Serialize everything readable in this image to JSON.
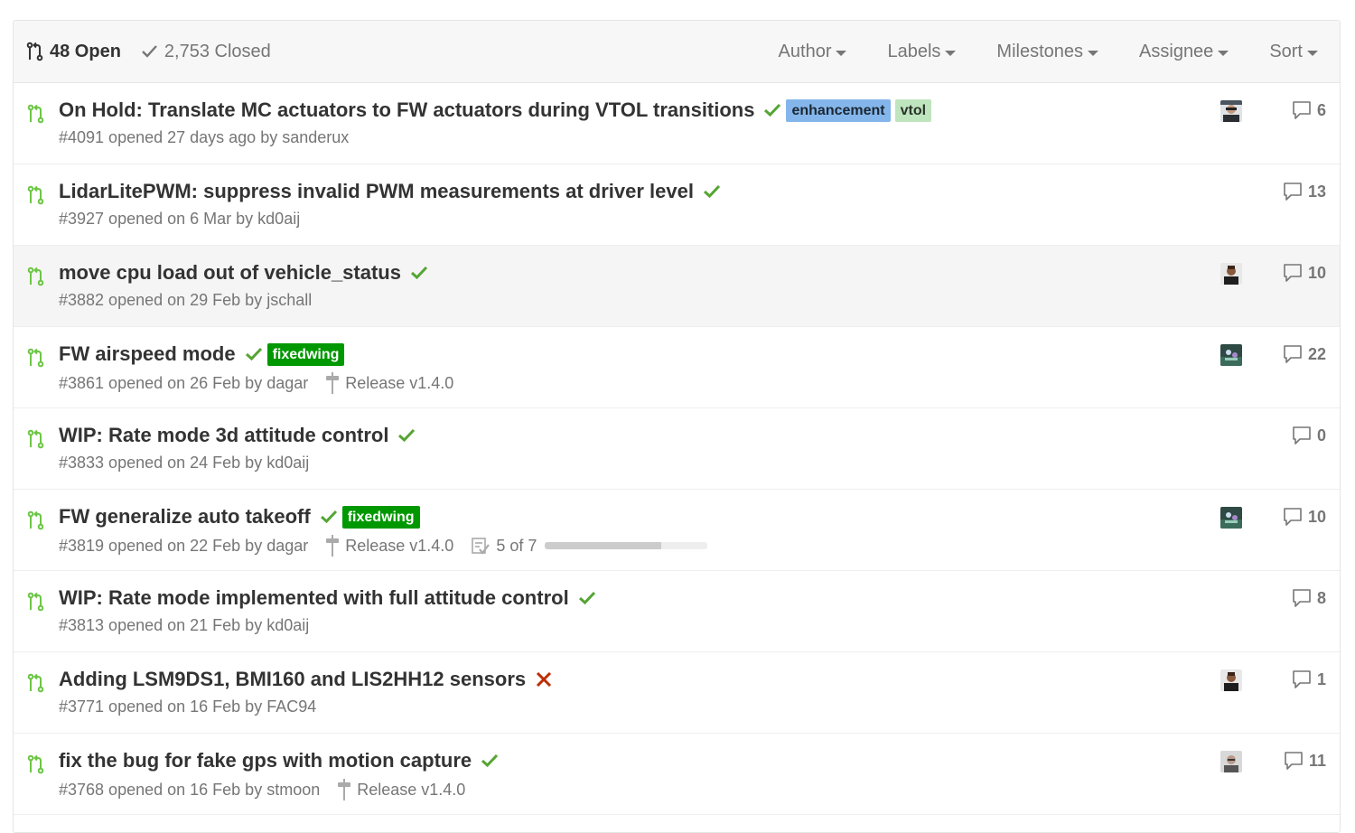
{
  "header": {
    "open_label": "48 Open",
    "closed_label": "2,753 Closed",
    "filters": [
      "Author",
      "Labels",
      "Milestones",
      "Assignee",
      "Sort"
    ]
  },
  "colors": {
    "success": "#55a532",
    "failure": "#bd2c00",
    "pr_open": "#6cc644"
  },
  "pull_requests": [
    {
      "title": "On Hold: Translate MC actuators to FW actuators during VTOL transitions",
      "status": "success",
      "labels": [
        {
          "name": "enhancement",
          "style": "enhancement"
        },
        {
          "name": "vtol",
          "style": "vtol"
        }
      ],
      "meta": "#4091 opened 27 days ago by sanderux",
      "milestone": null,
      "avatar": "avatar-a",
      "comments": "6"
    },
    {
      "title": "LidarLitePWM: suppress invalid PWM measurements at driver level",
      "status": "success",
      "labels": [],
      "meta": "#3927 opened on 6 Mar by kd0aij",
      "milestone": null,
      "avatar": null,
      "comments": "13"
    },
    {
      "title": "move cpu load out of vehicle_status",
      "status": "success",
      "labels": [],
      "meta": "#3882 opened on 29 Feb by jschall",
      "milestone": null,
      "avatar": "avatar-b",
      "comments": "10",
      "highlighted": true
    },
    {
      "title": "FW airspeed mode",
      "status": "success",
      "labels": [
        {
          "name": "fixedwing",
          "style": "fixedwing"
        }
      ],
      "meta": "#3861 opened on 26 Feb by dagar",
      "milestone": "Release v1.4.0",
      "avatar": "avatar-c",
      "comments": "22"
    },
    {
      "title": "WIP: Rate mode 3d attitude control",
      "status": "success",
      "labels": [],
      "meta": "#3833 opened on 24 Feb by kd0aij",
      "milestone": null,
      "avatar": null,
      "comments": "0"
    },
    {
      "title": "FW generalize auto takeoff",
      "status": "success",
      "labels": [
        {
          "name": "fixedwing",
          "style": "fixedwing"
        }
      ],
      "meta": "#3819 opened on 22 Feb by dagar",
      "milestone": "Release v1.4.0",
      "tasks": {
        "text": "5 of 7",
        "fraction": 0.714
      },
      "avatar": "avatar-c",
      "comments": "10"
    },
    {
      "title": "WIP: Rate mode implemented with full attitude control",
      "status": "success",
      "labels": [],
      "meta": "#3813 opened on 21 Feb by kd0aij",
      "milestone": null,
      "avatar": null,
      "comments": "8"
    },
    {
      "title": "Adding LSM9DS1, BMI160 and LIS2HH12 sensors",
      "status": "failure",
      "labels": [],
      "meta": "#3771 opened on 16 Feb by FAC94",
      "milestone": null,
      "avatar": "avatar-b",
      "comments": "1"
    },
    {
      "title": "fix the bug for fake gps with motion capture",
      "status": "success",
      "labels": [],
      "meta": "#3768 opened on 16 Feb by stmoon",
      "milestone": "Release v1.4.0",
      "avatar": "avatar-d",
      "comments": "11"
    }
  ]
}
